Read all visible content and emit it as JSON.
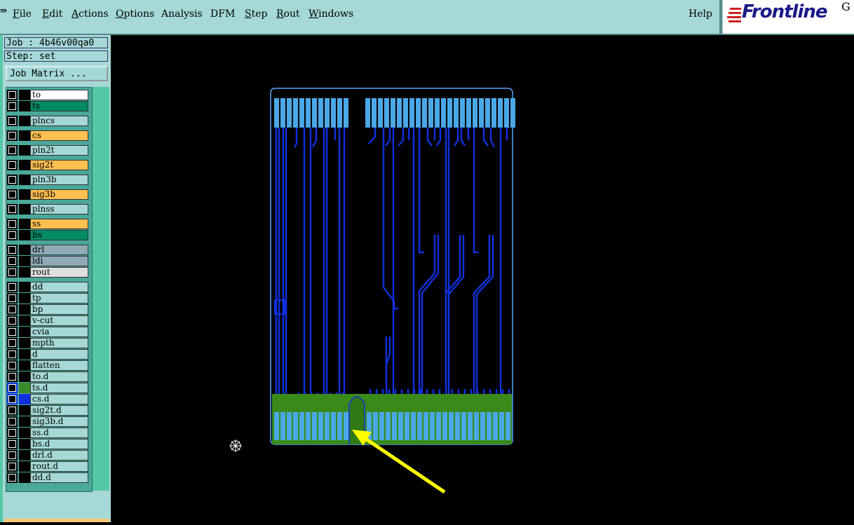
{
  "menu": {
    "items": [
      {
        "label": "File",
        "key": "F",
        "rest": "ile"
      },
      {
        "label": "Edit",
        "key": "E",
        "rest": "dit"
      },
      {
        "label": "Actions",
        "key": "A",
        "rest": "ctions"
      },
      {
        "label": "Options",
        "key": "O",
        "rest": "ptions"
      },
      {
        "label": "Analysis",
        "key": "",
        "rest": "Analysis"
      },
      {
        "label": "DFM",
        "key": "",
        "rest": "DFM"
      },
      {
        "label": "Step",
        "key": "S",
        "rest": "tep"
      },
      {
        "label": "Rout",
        "key": "R",
        "rest": "out"
      },
      {
        "label": "Windows",
        "key": "W",
        "rest": "indows"
      }
    ],
    "help": "Help"
  },
  "logo": {
    "text": "Frontline",
    "corner": "G"
  },
  "job": {
    "line": "Job : 4b46v00qa0",
    "step": "Step: set",
    "matrix_button": "Job Matrix ..."
  },
  "layers": [
    {
      "name": "to",
      "color": "#ffffff"
    },
    {
      "name": "ts",
      "color": "#008a64"
    },
    {
      "name": "plncs",
      "color": "#a6d8d8"
    },
    {
      "name": "cs",
      "color": "#ffc050"
    },
    {
      "name": "pln2t",
      "color": "#a6d8d8"
    },
    {
      "name": "sig2t",
      "color": "#ffc050"
    },
    {
      "name": "pln3b",
      "color": "#a6d8d8"
    },
    {
      "name": "sig3b",
      "color": "#ffc050"
    },
    {
      "name": "plnss",
      "color": "#a6d8d8"
    },
    {
      "name": "ss",
      "color": "#ffc050"
    },
    {
      "name": "bs",
      "color": "#008a64"
    },
    {
      "name": "drl",
      "color": "#90aab8"
    },
    {
      "name": "ldi",
      "color": "#90aab8"
    },
    {
      "name": "rout",
      "color": "#e0e0e0"
    },
    {
      "name": "dd",
      "color": "#a6d8d8"
    },
    {
      "name": "tp",
      "color": "#a6d8d8"
    },
    {
      "name": "bp",
      "color": "#a6d8d8"
    },
    {
      "name": "v-cut",
      "color": "#a6d8d8"
    },
    {
      "name": "cvia",
      "color": "#a6d8d8"
    },
    {
      "name": "mpth",
      "color": "#a6d8d8"
    },
    {
      "name": "d",
      "color": "#a6d8d8"
    },
    {
      "name": "flatten",
      "color": "#a6d8d8"
    },
    {
      "name": "to.d",
      "color": "#a6d8d8"
    },
    {
      "name": "ts.d",
      "color": "#a6d8d8",
      "active": true,
      "swatch": "#3a8a2a"
    },
    {
      "name": "cs.d",
      "color": "#a6d8d8",
      "active": true,
      "swatch": "#1030e0"
    },
    {
      "name": "sig2t.d",
      "color": "#a6d8d8"
    },
    {
      "name": "sig3b.d",
      "color": "#a6d8d8"
    },
    {
      "name": "ss.d",
      "color": "#a6d8d8"
    },
    {
      "name": "bs.d",
      "color": "#a6d8d8"
    },
    {
      "name": "drl.d",
      "color": "#a6d8d8"
    },
    {
      "name": "rout.d",
      "color": "#a6d8d8"
    },
    {
      "name": "dd.d",
      "color": "#a6d8d8"
    }
  ],
  "colors": {
    "board_outline": "#5aa8ff",
    "trace": "#1030e0",
    "pad": "#4aa8e8",
    "copper_fill": "#3a8a1a",
    "arrow": "#ffff00"
  }
}
